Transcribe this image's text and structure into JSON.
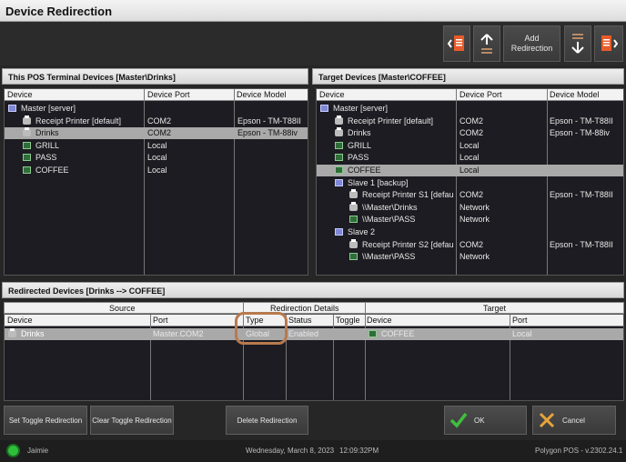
{
  "window": {
    "title": "Device Redirection"
  },
  "toolbar": {
    "add_redirection_label": "Add\nRedirection"
  },
  "left_panel": {
    "title": "This POS Terminal Devices [Master\\Drinks]",
    "columns": [
      "Device",
      "Device Port",
      "Device Model"
    ],
    "rows": [
      {
        "device": "Master [server]",
        "port": "",
        "model": "",
        "icon": "server-icon"
      },
      {
        "device": "Receipt Printer [default]",
        "port": "COM2",
        "model": "Epson - TM-T88II",
        "icon": "printer-icon"
      },
      {
        "device": "Drinks",
        "port": "COM2",
        "model": "Epson - TM-88iv",
        "icon": "printer-icon"
      },
      {
        "device": "GRILL",
        "port": "Local",
        "model": "",
        "icon": "kitchen-display-icon"
      },
      {
        "device": "PASS",
        "port": "Local",
        "model": "",
        "icon": "kitchen-display-icon"
      },
      {
        "device": "COFFEE",
        "port": "Local",
        "model": "",
        "icon": "kitchen-display-icon"
      }
    ]
  },
  "right_panel": {
    "title": "Target Devices [Master\\COFFEE]",
    "columns": [
      "Device",
      "Device Port",
      "Device Model"
    ],
    "rows": [
      {
        "device": "Master [server]",
        "port": "",
        "model": "",
        "icon": "server-icon"
      },
      {
        "device": "Receipt Printer [default]",
        "port": "COM2",
        "model": "Epson - TM-T88II",
        "icon": "printer-icon"
      },
      {
        "device": "Drinks",
        "port": "COM2",
        "model": "Epson - TM-88iv",
        "icon": "printer-icon"
      },
      {
        "device": "GRILL",
        "port": "Local",
        "model": "",
        "icon": "kitchen-display-icon"
      },
      {
        "device": "PASS",
        "port": "Local",
        "model": "",
        "icon": "kitchen-display-icon"
      },
      {
        "device": "COFFEE",
        "port": "Local",
        "model": "",
        "icon": "kitchen-display-icon"
      },
      {
        "device": "Slave 1 [backup]",
        "port": "",
        "model": "",
        "icon": "server-icon"
      },
      {
        "device": "Receipt Printer S1 [defau",
        "port": "COM2",
        "model": "Epson - TM-T88II",
        "icon": "printer-icon"
      },
      {
        "device": "\\\\Master\\Drinks",
        "port": "Network",
        "model": "",
        "icon": "printer-icon"
      },
      {
        "device": "\\\\Master\\PASS",
        "port": "Network",
        "model": "",
        "icon": "kitchen-display-icon"
      },
      {
        "device": "Slave 2",
        "port": "",
        "model": "",
        "icon": "server-icon"
      },
      {
        "device": "Receipt Printer S2 [defau",
        "port": "COM2",
        "model": "Epson - TM-T88II",
        "icon": "printer-icon"
      },
      {
        "device": "\\\\Master\\PASS",
        "port": "Network",
        "model": "",
        "icon": "kitchen-display-icon"
      }
    ]
  },
  "redirected": {
    "title": "Redirected Devices  [Drinks --> COFFEE]",
    "group_headers": {
      "source": "Source",
      "details": "Redirection Details",
      "target": "Target"
    },
    "columns": [
      "Device",
      "Port",
      "Type",
      "Status",
      "Toggle",
      "Device",
      "Port"
    ],
    "rows": [
      {
        "device": "Drinks",
        "port": "Master.COM2",
        "type": "Global",
        "status": "Enabled",
        "toggle": "",
        "target_device": "COFFEE",
        "target_port": "Local"
      }
    ]
  },
  "buttons": {
    "set_toggle": "Set Toggle Redirection",
    "clear_toggle": "Clear Toggle Redirection",
    "delete": "Delete Redirection",
    "ok": "OK",
    "cancel": "Cancel"
  },
  "status_bar": {
    "user": "Jaimie",
    "date": "Wednesday, March  8, 2023",
    "time": "12:09:32PM",
    "version": "Polygon POS - v.2302.24.1"
  }
}
